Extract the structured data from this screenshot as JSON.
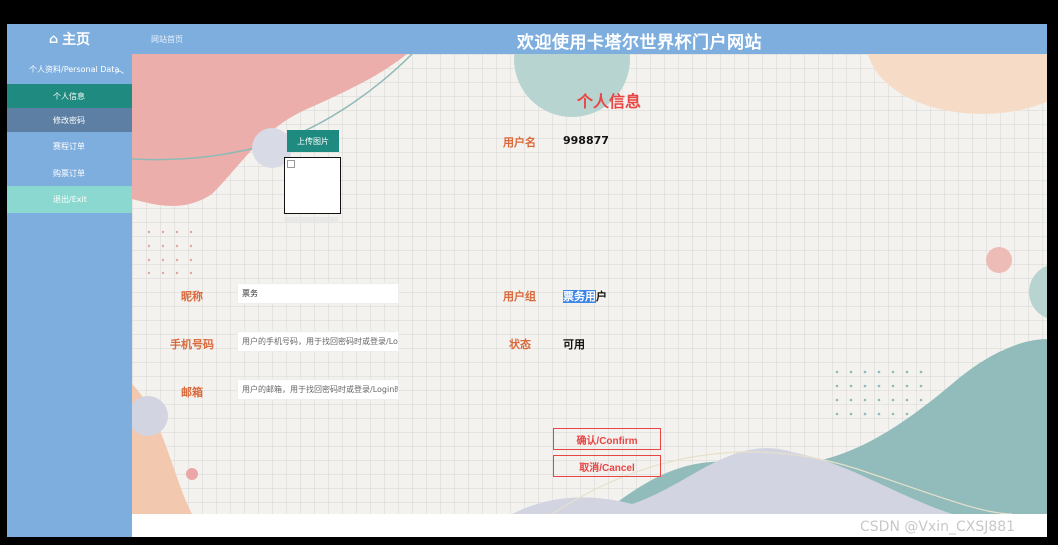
{
  "header": {
    "home_label": "主页",
    "home_icon": "home-icon",
    "breadcrumb": "网站首页",
    "site_title": "欢迎使用卡塔尔世界杯门户网站"
  },
  "sidebar": {
    "group_label": "个人资料/Personal Data",
    "items": [
      {
        "label": "个人信息",
        "active": true
      },
      {
        "label": "修改密码"
      },
      {
        "label": "赛程订单"
      },
      {
        "label": "购票订单"
      },
      {
        "label": "退出/Exit"
      }
    ]
  },
  "profile": {
    "heading": "个人信息",
    "upload_label": "上传图片",
    "username_label": "用户名",
    "username_value": "998877",
    "nickname_label": "昵称",
    "nickname_value": "票务",
    "phone_label": "手机号码",
    "phone_placeholder": "用户的手机号码，用于找回密码时或登录/Login时",
    "email_label": "邮箱",
    "email_placeholder": "用户的邮箱，用于找回密码时或登录/Login时",
    "group_label": "用户组",
    "group_value_selected": "票务用",
    "group_value_rest": "户",
    "status_label": "状态",
    "status_value": "可用",
    "confirm_label": "确认/Confirm",
    "cancel_label": "取消/Cancel"
  },
  "colors": {
    "sidebar_bg": "#7eaede",
    "active_item": "#1f8a80",
    "exit_item": "#8ad8cf",
    "heading_red": "#e84545",
    "label_orange": "#d96a3c"
  },
  "watermark": "CSDN @Vxin_CXSJ881"
}
